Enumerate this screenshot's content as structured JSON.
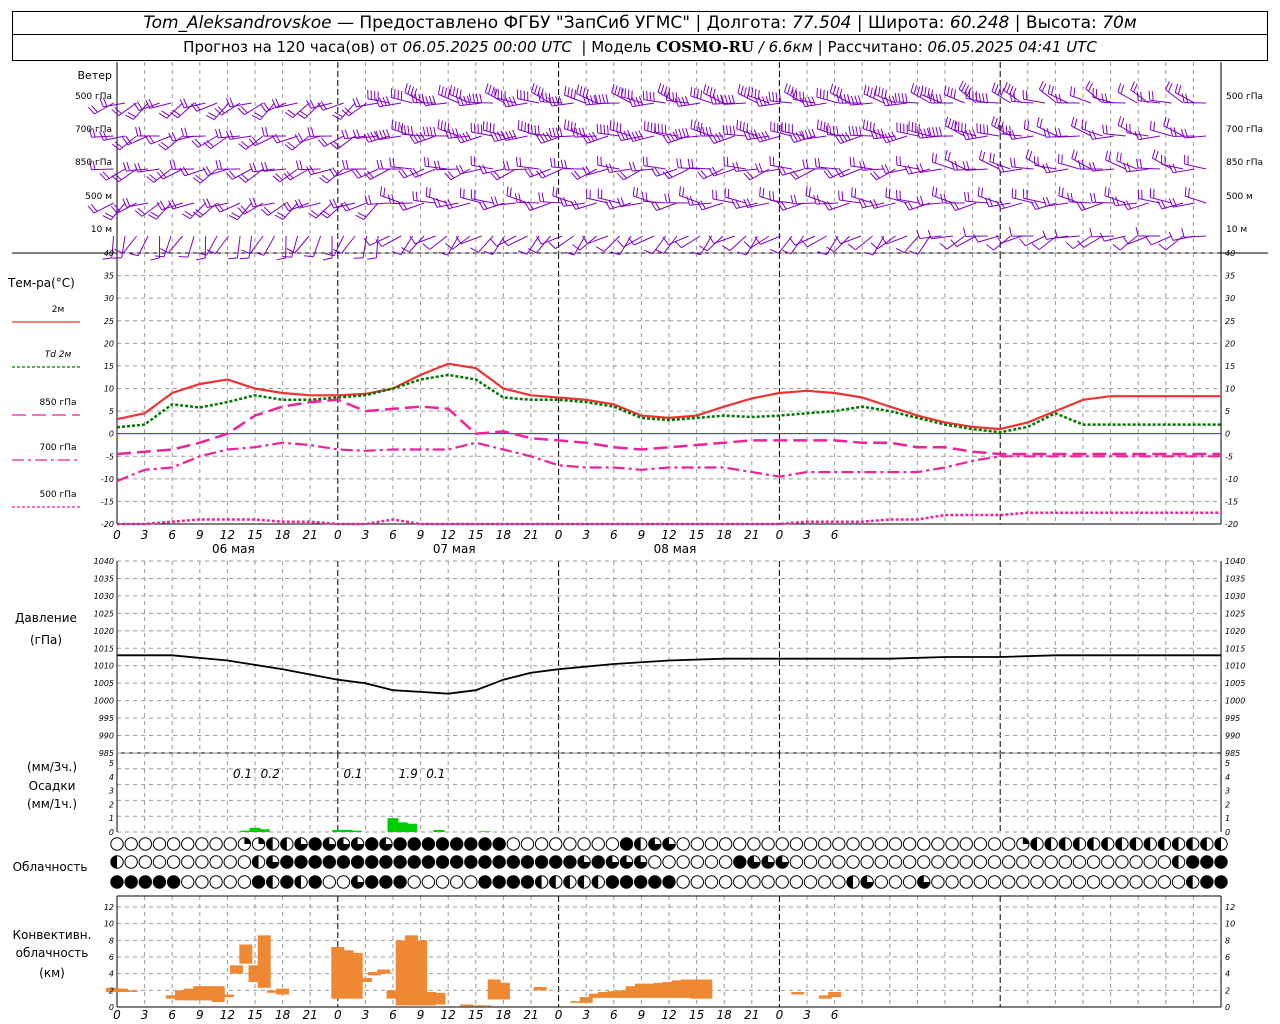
{
  "header": {
    "station": "Tom_Aleksandrovskoe",
    "provider": "— Предоставлено ФГБУ \"ЗапСиб УГМС\"",
    "lon_label": "Долгота:",
    "lon": "77.504",
    "lat_label": "Широта:",
    "lat": "60.248",
    "alt_label": "Высота:",
    "alt": "70м",
    "forecast_label": "Прогноз на 120 часа(ов) от",
    "forecast_start": "06.05.2025 00:00 UTC",
    "model_label": "Модель",
    "model": "COSMO-RU",
    "resolution": "/ 6.6км",
    "calc_label": "Рассчитано:",
    "calc_time": "06.05.2025 04:41 UTC"
  },
  "time_axis": {
    "hour_ticks": [
      "0",
      "3",
      "6",
      "9",
      "12",
      "15",
      "18",
      "21",
      "0",
      "3",
      "6",
      "9",
      "12",
      "15",
      "18",
      "21",
      "0",
      "3",
      "6",
      "9",
      "12",
      "15",
      "18",
      "21",
      "0",
      "3",
      "6"
    ],
    "days": [
      "06 мая",
      "07 мая",
      "08 мая"
    ]
  },
  "colors": {
    "t2m": "#ee3333",
    "td": "#007700",
    "iso": "#ee2299",
    "barb": "#8000c0",
    "precip": "#00cc00",
    "conv": "#ee8833",
    "pres": "#000000",
    "grid": "#9a9a9a"
  },
  "panels": {
    "wind": {
      "title": "Ветер",
      "levels": [
        "500 гПа",
        "700 гПа",
        "850 гПа",
        "500 м",
        "10   м"
      ]
    },
    "temp": {
      "title": "Тем-ра(°С)",
      "legend": [
        {
          "label": "2м"
        },
        {
          "label": "Td 2м"
        },
        {
          "label": "850 гПа"
        },
        {
          "label": "700 гПа"
        },
        {
          "label": "500 гПа"
        }
      ]
    },
    "pres": {
      "title1": "Давление",
      "title2": "(гПа)"
    },
    "prec": {
      "label1": "(мм/3ч.)",
      "label2": "Осадки",
      "label3": "(мм/1ч.)"
    },
    "cloud": {
      "title": "Облачность"
    },
    "conv": {
      "title1": "Конвективн.",
      "title2": "облачность",
      "title3": "(км)"
    }
  },
  "chart_data": [
    {
      "type": "line",
      "panel": "temperature",
      "x_hours": [
        0,
        3,
        6,
        9,
        12,
        15,
        18,
        21,
        24,
        27,
        30,
        33,
        36,
        39,
        42,
        45,
        48,
        51,
        54,
        57,
        60,
        63,
        66,
        69,
        72,
        75,
        78,
        81,
        84,
        87,
        90,
        93,
        96,
        99,
        102,
        105,
        108,
        111,
        114,
        117,
        120
      ],
      "ylim": [
        -20,
        40
      ],
      "yticks": [
        -20,
        -15,
        -10,
        -5,
        0,
        5,
        10,
        15,
        20,
        25,
        30,
        35,
        40
      ],
      "series": [
        {
          "name": "2м",
          "values": [
            3.2,
            4.5,
            9,
            11,
            12,
            10,
            9,
            8.5,
            8.5,
            8.8,
            10,
            13,
            15.5,
            14.5,
            10,
            8.5,
            8,
            7.5,
            6.5,
            4,
            3.5,
            4,
            6,
            7.8,
            9,
            9.5,
            9,
            8,
            6,
            4,
            2.5,
            1.5,
            1,
            2.5,
            5,
            7.5,
            8.3,
            8.3,
            8.3,
            8.3,
            8.3
          ]
        },
        {
          "name": "Td 2м",
          "values": [
            1.4,
            2,
            6.5,
            5.8,
            7,
            8.5,
            7.5,
            7.5,
            8,
            8.5,
            10,
            12,
            13,
            12,
            8,
            7.5,
            7.5,
            7,
            6,
            3.5,
            3,
            3.5,
            4,
            3.7,
            4,
            4.5,
            5,
            6,
            5,
            3.5,
            2,
            1,
            0.3,
            1.5,
            4.5,
            2,
            2,
            2,
            2,
            2,
            2
          ]
        },
        {
          "name": "850 гПа",
          "values": [
            -4.5,
            -4,
            -3.5,
            -2,
            0,
            4,
            6,
            7,
            7.5,
            5,
            5.5,
            6,
            5.5,
            0,
            0.5,
            -1,
            -1.5,
            -2,
            -3,
            -3.5,
            -3,
            -2.5,
            -2,
            -1.5,
            -1.5,
            -1.5,
            -1.5,
            -2,
            -2,
            -3,
            -3,
            -4,
            -4.5,
            -4.5,
            -4.5,
            -4.5,
            -4.5,
            -4.5,
            -4.5,
            -4.5,
            -4.5
          ]
        },
        {
          "name": "700 гПа",
          "values": [
            -10.5,
            -8,
            -7.5,
            -5,
            -3.5,
            -3,
            -2,
            -2.5,
            -3.5,
            -3.8,
            -3.5,
            -3.5,
            -3.5,
            -2,
            -3.5,
            -5,
            -7,
            -7.5,
            -7.5,
            -8,
            -7.5,
            -7.5,
            -7.5,
            -8.5,
            -9.5,
            -8.5,
            -8.5,
            -8.5,
            -8.5,
            -8.5,
            -7.5,
            -6,
            -5,
            -5,
            -5,
            -5,
            -5,
            -5,
            -5,
            -5,
            -5
          ]
        },
        {
          "name": "500 гПа",
          "values": [
            -20,
            -20,
            -19.5,
            -19,
            -19,
            -19,
            -19.5,
            -19.5,
            -20,
            -20,
            -19,
            -20,
            -20,
            -20,
            -20,
            -20,
            -20,
            -20,
            -20,
            -20,
            -20,
            -20,
            -20,
            -20,
            -20,
            -19.5,
            -19.5,
            -19.5,
            -19,
            -19,
            -18,
            -18,
            -18,
            -17.5,
            -17.5,
            -17.5,
            -17.5,
            -17.5,
            -17.5,
            -17.5,
            -17.5
          ]
        }
      ],
      "zero_line": 0
    },
    {
      "type": "line",
      "panel": "pressure",
      "x_hours": [
        0,
        6,
        12,
        18,
        24,
        27,
        30,
        33,
        36,
        39,
        42,
        45,
        48,
        54,
        60,
        66,
        72,
        78,
        84,
        90,
        96,
        102,
        108,
        114,
        120
      ],
      "ylim": [
        985,
        1040
      ],
      "yticks": [
        985,
        990,
        995,
        1000,
        1005,
        1010,
        1015,
        1020,
        1025,
        1030,
        1035,
        1040
      ],
      "series": [
        {
          "name": "",
          "values": [
            1013,
            1013,
            1011.5,
            1009,
            1006,
            1005,
            1003,
            1002.5,
            1002,
            1003,
            1006,
            1008,
            1009,
            1010.5,
            1011.5,
            1012,
            1012,
            1012,
            1012,
            1012.5,
            1012.5,
            1013,
            1013,
            1013,
            1013
          ]
        }
      ]
    },
    {
      "type": "bar",
      "panel": "precipitation",
      "ylim": [
        0,
        5
      ],
      "yticks": [
        0,
        1,
        2,
        3,
        4,
        5
      ],
      "labels_3h": [
        {
          "x_hours": 13,
          "text": "0.1"
        },
        {
          "x_hours": 16,
          "text": "0.2"
        },
        {
          "x_hours": 25,
          "text": "0.1"
        },
        {
          "x_hours": 31,
          "text": "1.9"
        },
        {
          "x_hours": 34,
          "text": "0.1"
        }
      ],
      "bars": [
        [
          14,
          0.1
        ],
        [
          15,
          0.3
        ],
        [
          16,
          0.2
        ],
        [
          24,
          0.15
        ],
        [
          25,
          0.15
        ],
        [
          26,
          0.1
        ],
        [
          30,
          1
        ],
        [
          31,
          0.7
        ],
        [
          32,
          0.6
        ],
        [
          35,
          0.15
        ],
        [
          40,
          0.05
        ]
      ]
    },
    {
      "type": "bar",
      "panel": "convective_cloud",
      "ylim": [
        0,
        13
      ],
      "yticks": [
        0,
        2,
        4,
        6,
        8,
        10,
        12
      ],
      "bars": [
        [
          -0.5,
          1.8,
          2.3
        ],
        [
          0.5,
          1.8,
          2.2
        ],
        [
          1.5,
          1.8,
          2
        ],
        [
          6,
          1,
          1.4
        ],
        [
          7,
          0.8,
          2
        ],
        [
          8,
          0.8,
          2.2
        ],
        [
          9,
          0.8,
          2.5
        ],
        [
          10,
          0.8,
          2.5
        ],
        [
          11,
          0.6,
          2.5
        ],
        [
          12,
          1.2,
          1.5
        ],
        [
          13,
          4,
          5
        ],
        [
          14,
          5.2,
          7.5
        ],
        [
          15,
          3,
          5
        ],
        [
          16,
          2.3,
          8.6
        ],
        [
          17,
          1.7,
          2
        ],
        [
          18,
          1.5,
          2.2
        ],
        [
          24,
          1,
          7.2
        ],
        [
          25,
          1,
          6.8
        ],
        [
          26,
          1,
          6.5
        ],
        [
          27,
          3,
          3.5
        ],
        [
          28,
          3.8,
          4.2
        ],
        [
          29,
          4,
          4.5
        ],
        [
          30,
          1,
          2
        ],
        [
          31,
          0.2,
          8
        ],
        [
          32,
          0.2,
          8.6
        ],
        [
          33,
          0.2,
          8
        ],
        [
          34,
          0.2,
          1.8
        ],
        [
          35,
          0.3,
          1.7
        ],
        [
          38,
          0.1,
          0.3
        ],
        [
          39,
          0.1,
          0.2
        ],
        [
          40,
          0.1,
          0.2
        ],
        [
          41,
          0.9,
          3.3
        ],
        [
          42,
          0.9,
          2.9
        ],
        [
          46,
          2,
          2.4
        ],
        [
          49,
          0.3,
          0.3
        ],
        [
          50,
          0.5,
          0.7
        ],
        [
          51,
          0.5,
          1.2
        ],
        [
          52,
          1.1,
          1.6
        ],
        [
          53,
          1.1,
          1.8
        ],
        [
          54,
          1.1,
          1.9
        ],
        [
          55,
          1.1,
          2
        ],
        [
          56,
          1.1,
          2.5
        ],
        [
          57,
          1.1,
          2.8
        ],
        [
          58,
          1.1,
          2.8
        ],
        [
          59,
          1.1,
          2.9
        ],
        [
          60,
          1.1,
          3
        ],
        [
          61,
          1.1,
          3.2
        ],
        [
          62,
          1.1,
          3.3
        ],
        [
          63,
          1,
          3.3
        ],
        [
          64,
          1,
          3.3
        ],
        [
          74,
          1.5,
          1.8
        ],
        [
          77,
          1,
          1.4
        ],
        [
          78,
          1.2,
          1.8
        ]
      ]
    }
  ],
  "cloud_rows": [
    "00000000011223433343444444440000000042330000000000000000000000001222222222222222222222222222222220000000000000000000",
    "20000000002344444444444444444444434333000000433300000000000000000000000000024443443400000000000000000000000000000002",
    "44444000004242400344400000444422222444440000000000002300030000000000000000002444200000000000000000000000000002444444"
  ]
}
